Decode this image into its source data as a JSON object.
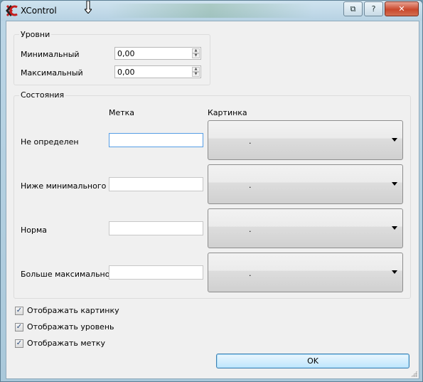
{
  "window": {
    "title": "XControl",
    "icon": "xcontrol-app-icon",
    "buttons": [
      "restore-icon",
      "help-icon",
      "close-icon"
    ],
    "button_glyphs": {
      "restore": "⧉",
      "help": "?",
      "close": "✕"
    }
  },
  "levels": {
    "title": "Уровни",
    "min_label": "Минимальный",
    "min_value": "0,00",
    "max_label": "Максимальный",
    "max_value": "0,00"
  },
  "states": {
    "title": "Состояния",
    "col_label": "Метка",
    "col_picture": "Картинка",
    "rows": [
      {
        "name": "Не определен",
        "label": "",
        "picture": "."
      },
      {
        "name": "Ниже минимального",
        "label": "",
        "picture": "."
      },
      {
        "name": "Норма",
        "label": "",
        "picture": "."
      },
      {
        "name": "Больше максимального",
        "label": "",
        "picture": "."
      }
    ]
  },
  "options": [
    {
      "label": "Отображать картинку",
      "checked": true
    },
    {
      "label": "Отображать уровень",
      "checked": true
    },
    {
      "label": "Отображать метку",
      "checked": true
    }
  ],
  "ok_label": "OK",
  "colors": {
    "accent": "#3c7fb1",
    "close": "#c9482c",
    "titlebar": "#b7d2e3"
  }
}
